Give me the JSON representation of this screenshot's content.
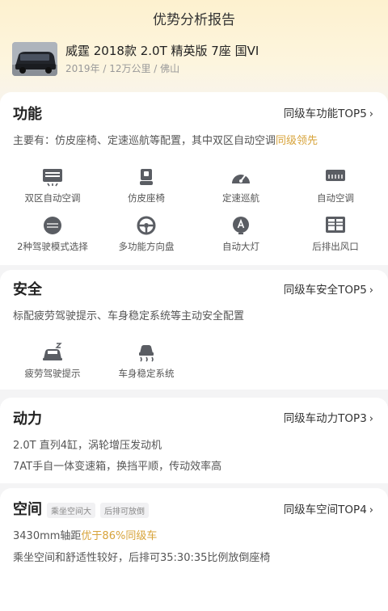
{
  "header": {
    "title": "优势分析报告",
    "car_name": "威霆 2018款 2.0T 精英版 7座 国VI",
    "car_meta": "2019年 / 12万公里 / 佛山"
  },
  "sections": {
    "function": {
      "title": "功能",
      "link": "同级车功能TOP5",
      "desc_prefix": "主要有：仿皮座椅、定速巡航等配置，其中双区自动空调",
      "desc_highlight": "同级领先",
      "features": [
        {
          "label": "双区自动空调",
          "icon": "dual-zone-ac-icon"
        },
        {
          "label": "仿皮座椅",
          "icon": "leather-seat-icon"
        },
        {
          "label": "定速巡航",
          "icon": "cruise-control-icon"
        },
        {
          "label": "自动空调",
          "icon": "auto-ac-icon"
        },
        {
          "label": "2种驾驶模式选择",
          "icon": "drive-mode-icon"
        },
        {
          "label": "多功能方向盘",
          "icon": "steering-wheel-icon"
        },
        {
          "label": "自动大灯",
          "icon": "auto-headlight-icon"
        },
        {
          "label": "后排出风口",
          "icon": "rear-vent-icon"
        }
      ]
    },
    "safety": {
      "title": "安全",
      "link": "同级车安全TOP5",
      "desc": "标配疲劳驾驶提示、车身稳定系统等主动安全配置",
      "features": [
        {
          "label": "疲劳驾驶提示",
          "icon": "fatigue-alert-icon"
        },
        {
          "label": "车身稳定系统",
          "icon": "stability-control-icon"
        }
      ]
    },
    "power": {
      "title": "动力",
      "link": "同级车动力TOP3",
      "line1": "2.0T 直列4缸，涡轮增压发动机",
      "line2": "7AT手自一体变速箱，换挡平顺，传动效率高"
    },
    "space": {
      "title": "空间",
      "tags": [
        "乘坐空间大",
        "后排可放倒"
      ],
      "link": "同级车空间TOP4",
      "line1_prefix": "3430mm轴距",
      "line1_highlight": "优于86%同级车",
      "line2": "乘坐空间和舒适性较好，后排可35:30:35比例放倒座椅"
    }
  },
  "colors": {
    "accent": "#d7a33a",
    "background": "#f4f4f5",
    "hero": "#fdf1cf"
  }
}
